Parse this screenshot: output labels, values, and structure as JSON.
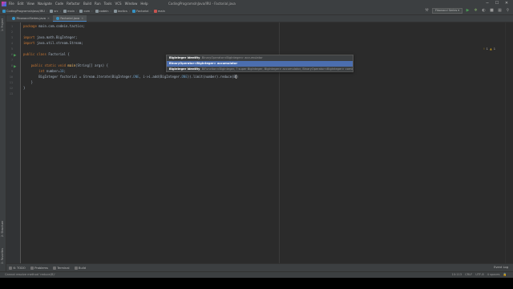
{
  "menubar": {
    "items": [
      "File",
      "Edit",
      "View",
      "Navigate",
      "Code",
      "Refactor",
      "Build",
      "Run",
      "Tools",
      "VCS",
      "Window",
      "Help"
    ],
    "window_title": "CodingProgramsInJava/IRU - Factorial.java",
    "controls": [
      "─",
      "☐",
      "✕"
    ]
  },
  "navbar": {
    "breadcrumbs": [
      "CodingProgramsInJava/IRU",
      "src",
      "main",
      "com",
      "codein",
      "tactics",
      "Factorial",
      "main"
    ],
    "run_config": "Fibonacci Series ▾"
  },
  "left_strip": {
    "top": [
      "1: Project"
    ],
    "bottom": [
      "2: Structure",
      "2: Favorites"
    ]
  },
  "tabs": [
    {
      "label": "FibonacciSeries.java",
      "active": false
    },
    {
      "label": "Factorial.java",
      "active": true
    }
  ],
  "editor": {
    "line_numbers": [
      "1",
      "2",
      "3",
      "4",
      "5",
      "6",
      "7",
      "8",
      "9",
      "10",
      "11",
      "12",
      "13"
    ],
    "lines": [
      {
        "parts": [
          {
            "c": "kw",
            "t": "package "
          },
          {
            "c": "plain",
            "t": "main.com.codein.tactics;"
          }
        ]
      },
      {
        "parts": []
      },
      {
        "parts": [
          {
            "c": "kw",
            "t": "import "
          },
          {
            "c": "plain",
            "t": "java.math.BigInteger;"
          }
        ]
      },
      {
        "parts": [
          {
            "c": "kw",
            "t": "import "
          },
          {
            "c": "plain",
            "t": "java.util.stream.Stream;"
          }
        ]
      },
      {
        "parts": []
      },
      {
        "parts": [
          {
            "c": "kw",
            "t": "public class "
          },
          {
            "c": "plain",
            "t": "Factorial {"
          }
        ]
      },
      {
        "parts": []
      },
      {
        "parts": [
          {
            "c": "kw",
            "t": "    public static void "
          },
          {
            "c": "fn",
            "t": "main"
          },
          {
            "c": "plain",
            "t": "(String[] args) {"
          }
        ]
      },
      {
        "parts": [
          {
            "c": "kw",
            "t": "        int "
          },
          {
            "c": "plain",
            "t": "number="
          },
          {
            "c": "num",
            "t": "10"
          },
          {
            "c": "plain",
            "t": ";"
          }
        ]
      },
      {
        "parts": [
          {
            "c": "plain",
            "t": "        BigInteger factorial = Stream."
          },
          {
            "c": "plain",
            "t": "iterate(BigInteger."
          },
          {
            "c": "num",
            "t": "ONE"
          },
          {
            "c": "plain",
            "t": ", i->i.add(BigInteger."
          },
          {
            "c": "num",
            "t": "ONE"
          },
          {
            "c": "plain",
            "t": ")).limit(number).reduce(B"
          },
          {
            "c": "caret",
            "t": ""
          },
          {
            "c": "plain",
            "t": ")"
          }
        ]
      },
      {
        "parts": [
          {
            "c": "plain",
            "t": "    }"
          }
        ]
      },
      {
        "parts": [
          {
            "c": "plain",
            "t": "}"
          }
        ]
      },
      {
        "parts": []
      }
    ],
    "hints": {
      "errors": "1",
      "warnings": "1"
    }
  },
  "completion_popup": {
    "rows": [
      {
        "bold": "BigInteger identity",
        "rest": ", BinaryOperator<BigInteger> accumulator",
        "selected": false
      },
      {
        "bold": "BinaryOperator<BigInteger> accumulator",
        "rest": "",
        "selected": true
      },
      {
        "bold": "BigInteger identity",
        "rest": ", BiFunction<BigInteger, ? super BigInteger, BigInteger> accumulator, BinaryOperator<BigInteger> combiner",
        "selected": false
      }
    ]
  },
  "bottom_tools": {
    "items": [
      "6: TODO",
      "Problems",
      "Terminal",
      "Build"
    ],
    "event_log": "Event Log"
  },
  "statusbar": {
    "message": "Cannot resolve method 'reduce(B)'",
    "position": "10:113",
    "line_sep": "CRLF",
    "encoding": "UTF-8",
    "indent": "4 spaces"
  }
}
